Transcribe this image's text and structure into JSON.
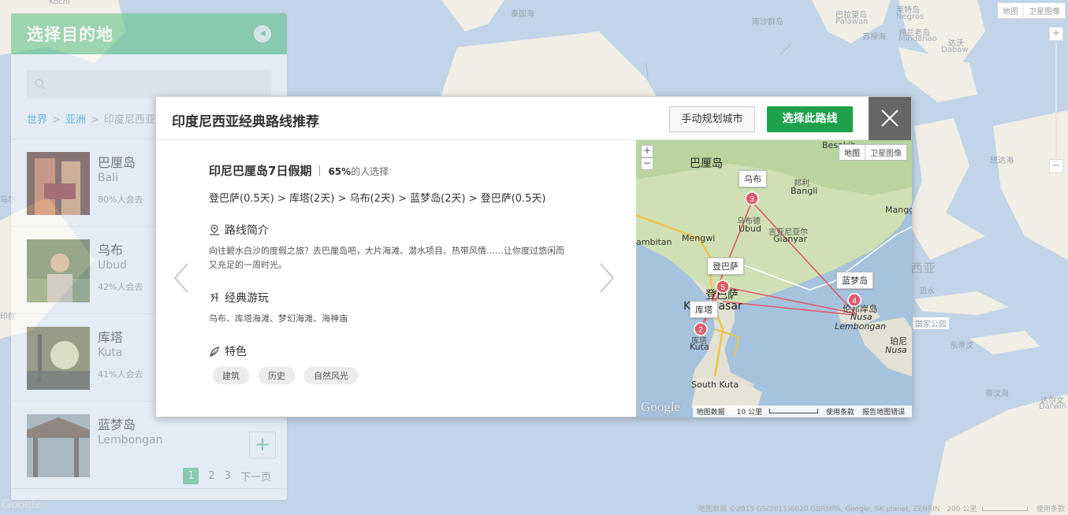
{
  "background_map": {
    "labels": [
      {
        "text": "Kochi",
        "sub": true
      },
      {
        "text": "泰国海"
      },
      {
        "text": "南沙群岛"
      },
      {
        "text": "巴拉望岛"
      },
      {
        "text": "Palawan",
        "sub": true
      },
      {
        "text": "苏禄海"
      },
      {
        "text": "莱特岛"
      },
      {
        "text": "Negros",
        "sub": true
      },
      {
        "text": "棉兰老岛"
      },
      {
        "text": "Mindanao",
        "sub": true
      },
      {
        "text": "达沃"
      },
      {
        "text": "Dabaw",
        "sub": true
      },
      {
        "text": "泗水"
      },
      {
        "text": "帝汶海"
      },
      {
        "text": "达尔文"
      },
      {
        "text": "Darwin",
        "sub": true
      },
      {
        "text": "西亚",
        "big": true
      },
      {
        "text": "班达海"
      },
      {
        "text": "东帝汶"
      },
      {
        "text": "国家公园"
      },
      {
        "text": "马尔"
      },
      {
        "text": "印度"
      }
    ],
    "map_type": {
      "map": "地图",
      "satellite": "卫星图像"
    },
    "zoom": {
      "in": "+",
      "out": "−"
    },
    "attribution": "地图数据 ©2015 GS(2011)6020 GBRMPA, Google, SK planet, ZENRIN",
    "scale": "200 公里",
    "terms": "使用条款",
    "logo": "Google"
  },
  "dest_panel": {
    "title": "选择目的地",
    "collapse_icon": "chevron-left-icon",
    "search_placeholder": "",
    "breadcrumb": {
      "world": "世界",
      "continent": "亚洲",
      "country": "印度尼西亚",
      "separator": ">"
    },
    "items": [
      {
        "cn": "巴厘岛",
        "en": "Bali",
        "pct": "80%人会去"
      },
      {
        "cn": "乌布",
        "en": "Ubud",
        "pct": "42%人会去"
      },
      {
        "cn": "库塔",
        "en": "Kuta",
        "pct": "41%人会去"
      },
      {
        "cn": "蓝梦岛",
        "en": "Lembongan",
        "pct": ""
      }
    ],
    "add_label": "+",
    "pager": {
      "pages": [
        "1",
        "2",
        "3"
      ],
      "current": "1",
      "next": "下一页"
    }
  },
  "route_modal": {
    "title": "印度尼西亚经典路线推荐",
    "manual_button": "手动规划城市",
    "select_button": "选择此路线",
    "route_name": "印尼巴厘岛7日假期",
    "share_pct": "65%",
    "share_text": "的人选择",
    "path": "登巴萨(0.5天) > 库塔(2天) > 乌布(2天) > 蓝梦岛(2天) > 登巴萨(0.5天)",
    "intro_heading": "路线简介",
    "intro_text": "向往碧水白沙的度假之旅？去巴厘岛吧，大片海滩、潜水项目、热带风情……让你度过悠闲而又充足的一周时光。",
    "play_heading": "经典游玩",
    "play_text": "乌布、库塔海滩、梦幻海滩、海神庙",
    "feature_heading": "特色",
    "tags": [
      "建筑",
      "历史",
      "自然风光"
    ]
  },
  "route_map": {
    "map_type": {
      "map": "地图",
      "satellite": "卫星图像"
    },
    "zoom": {
      "in": "+",
      "out": "−"
    },
    "labels": {
      "besakih": "Besakih",
      "bali": "巴厘岛",
      "bangli_cn": "邦利",
      "bangli": "Bangli",
      "mangg": "Mangg",
      "mengwi": "Mengwi",
      "ambitan": "ambitan",
      "ubud_cn": "乌布德",
      "ubud": "Ubud",
      "gianyar_cn": "吉亚尼亚尔",
      "gianyar": "Gianyar",
      "denpasar_cn": "登巴萨",
      "denpasar": "Kdenpasar",
      "kuta_cn": "库塔",
      "kuta": "Kuta",
      "south_kuta": "South Kuta",
      "nusa_cn": "伦邦岸岛",
      "nusa": "Nusa",
      "lembongan": "Lembongan",
      "penida_cn": "珀尼",
      "penida": "Nusa"
    },
    "callouts": {
      "ubud": "乌布",
      "denpasar": "登巴萨",
      "kuta": "库塔",
      "lembongan": "蓝梦岛"
    },
    "markers": [
      {
        "n": "2",
        "place": "库塔"
      },
      {
        "n": "3",
        "place": "乌布"
      },
      {
        "n": "4",
        "place": "蓝梦岛"
      },
      {
        "n": "5",
        "place": "登巴萨"
      }
    ],
    "footer": {
      "data": "地图数据",
      "scale": "10 公里",
      "terms": "使用条款",
      "report": "报告地图错误"
    },
    "logo": "Google",
    "route_color": "#e05a6a"
  }
}
